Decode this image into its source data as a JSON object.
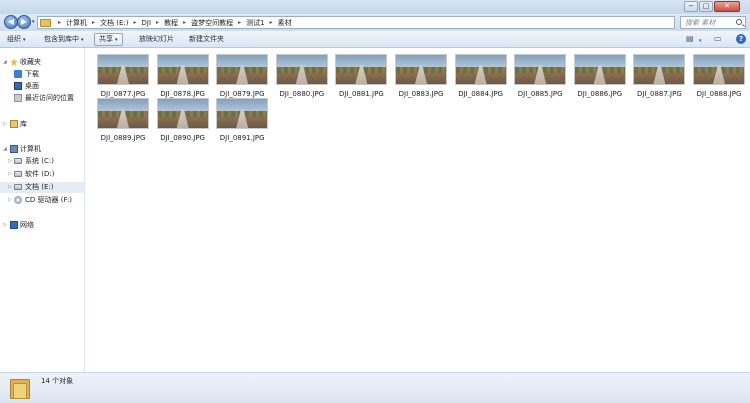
{
  "window": {
    "title": "",
    "controls": {
      "minimize": "−",
      "maximize": "□",
      "close": "✕"
    }
  },
  "address": {
    "back_glyph": "◀",
    "forward_glyph": "▶",
    "breadcrumbs": [
      "计算机",
      "文档 (E:)",
      "DJI",
      "教程",
      "盗梦空间教程",
      "测试1",
      "素材"
    ],
    "separator": "▸",
    "search_placeholder": "搜索 素材"
  },
  "toolbar": {
    "organize": "组织",
    "include_library": "包含到库中",
    "share": "共享",
    "slideshow": "放映幻灯片",
    "new_folder": "新建文件夹",
    "help": "?"
  },
  "nav": {
    "favorites": "收藏夹",
    "downloads": "下载",
    "desktop": "桌面",
    "recent": "最近访问的位置",
    "libraries": "库",
    "computer": "计算机",
    "drive_c": "系统 (C:)",
    "drive_d": "软件 (D:)",
    "drive_e": "文档 (E:)",
    "drive_f": "CD 驱动器 (F:)",
    "network": "网络"
  },
  "files": [
    "DJI_0877.JPG",
    "DJI_0878.JPG",
    "DJI_0879.JPG",
    "DJI_0880.JPG",
    "DJI_0881.JPG",
    "DJI_0883.JPG",
    "DJI_0884.JPG",
    "DJI_0885.JPG",
    "DJI_0886.JPG",
    "DJI_0887.JPG",
    "DJI_0888.JPG",
    "DJI_0889.JPG",
    "DJI_0890.JPG",
    "DJI_0891.JPG"
  ],
  "status": {
    "count_text": "14 个对象"
  },
  "colors": {
    "accent": "#3c72b8",
    "folder": "#dcb552",
    "selection": "#e5ecf5"
  }
}
